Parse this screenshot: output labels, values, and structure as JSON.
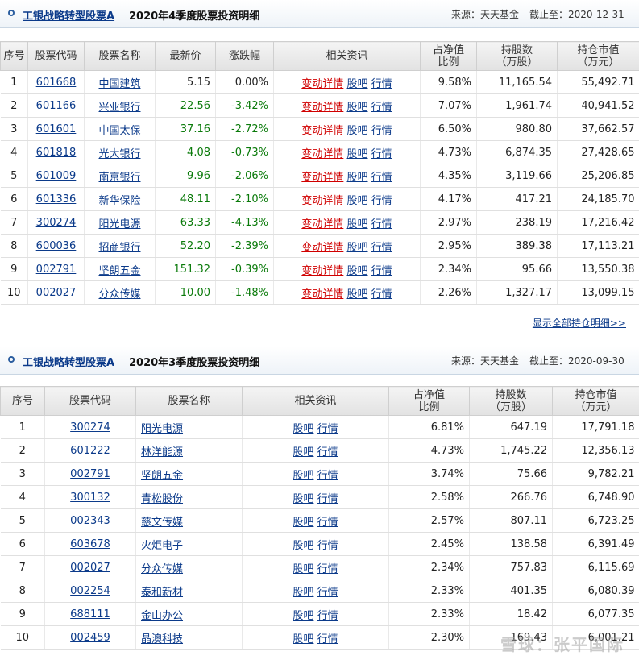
{
  "q4": {
    "fund_name": "工银战略转型股票A",
    "title": "2020年4季度股票投资明细",
    "source": "来源：天天基金",
    "deadline": "截止至：2020-12-31",
    "headers": [
      "序号",
      "股票代码",
      "股票名称",
      "最新价",
      "涨跌幅",
      "相关资讯",
      "占净值\n比例",
      "持股数\n（万股）",
      "持仓市值\n（万元）"
    ],
    "info_labels": {
      "change": "变动详情",
      "bar": "股吧",
      "quote": "行情"
    },
    "rows": [
      {
        "no": "1",
        "code": "601668",
        "name": "中国建筑",
        "price": "5.15",
        "chg": "0.00%",
        "dir": "flat",
        "ratio": "9.58%",
        "shares": "11,165.54",
        "value": "55,492.71"
      },
      {
        "no": "2",
        "code": "601166",
        "name": "兴业银行",
        "price": "22.56",
        "chg": "-3.42%",
        "dir": "down",
        "ratio": "7.07%",
        "shares": "1,961.74",
        "value": "40,941.52"
      },
      {
        "no": "3",
        "code": "601601",
        "name": "中国太保",
        "price": "37.16",
        "chg": "-2.72%",
        "dir": "down",
        "ratio": "6.50%",
        "shares": "980.80",
        "value": "37,662.57"
      },
      {
        "no": "4",
        "code": "601818",
        "name": "光大银行",
        "price": "4.08",
        "chg": "-0.73%",
        "dir": "down",
        "ratio": "4.73%",
        "shares": "6,874.35",
        "value": "27,428.65"
      },
      {
        "no": "5",
        "code": "601009",
        "name": "南京银行",
        "price": "9.96",
        "chg": "-2.06%",
        "dir": "down",
        "ratio": "4.35%",
        "shares": "3,119.66",
        "value": "25,206.85"
      },
      {
        "no": "6",
        "code": "601336",
        "name": "新华保险",
        "price": "48.11",
        "chg": "-2.10%",
        "dir": "down",
        "ratio": "4.17%",
        "shares": "417.21",
        "value": "24,185.70"
      },
      {
        "no": "7",
        "code": "300274",
        "name": "阳光电源",
        "price": "63.33",
        "chg": "-4.13%",
        "dir": "down",
        "ratio": "2.97%",
        "shares": "238.19",
        "value": "17,216.42"
      },
      {
        "no": "8",
        "code": "600036",
        "name": "招商银行",
        "price": "52.20",
        "chg": "-2.39%",
        "dir": "down",
        "ratio": "2.95%",
        "shares": "389.38",
        "value": "17,113.21"
      },
      {
        "no": "9",
        "code": "002791",
        "name": "坚朗五金",
        "price": "151.32",
        "chg": "-0.39%",
        "dir": "down",
        "ratio": "2.34%",
        "shares": "95.66",
        "value": "13,550.38"
      },
      {
        "no": "10",
        "code": "002027",
        "name": "分众传媒",
        "price": "10.00",
        "chg": "-1.48%",
        "dir": "down",
        "ratio": "2.26%",
        "shares": "1,327.17",
        "value": "13,099.15"
      }
    ],
    "show_all": "显示全部持仓明细>>"
  },
  "q3": {
    "fund_name": "工银战略转型股票A",
    "title": "2020年3季度股票投资明细",
    "source": "来源：天天基金",
    "deadline": "截止至：2020-09-30",
    "headers": [
      "序号",
      "股票代码",
      "股票名称",
      "相关资讯",
      "占净值\n比例",
      "持股数\n（万股）",
      "持仓市值\n（万元）"
    ],
    "info_labels": {
      "bar": "股吧",
      "quote": "行情"
    },
    "rows": [
      {
        "no": "1",
        "code": "300274",
        "name": "阳光电源",
        "ratio": "6.81%",
        "shares": "647.19",
        "value": "17,791.18"
      },
      {
        "no": "2",
        "code": "601222",
        "name": "林洋能源",
        "ratio": "4.73%",
        "shares": "1,745.22",
        "value": "12,356.13"
      },
      {
        "no": "3",
        "code": "002791",
        "name": "坚朗五金",
        "ratio": "3.74%",
        "shares": "75.66",
        "value": "9,782.21"
      },
      {
        "no": "4",
        "code": "300132",
        "name": "青松股份",
        "ratio": "2.58%",
        "shares": "266.76",
        "value": "6,748.90"
      },
      {
        "no": "5",
        "code": "002343",
        "name": "慈文传媒",
        "ratio": "2.57%",
        "shares": "807.11",
        "value": "6,723.25"
      },
      {
        "no": "6",
        "code": "603678",
        "name": "火炬电子",
        "ratio": "2.45%",
        "shares": "138.58",
        "value": "6,391.49"
      },
      {
        "no": "7",
        "code": "002027",
        "name": "分众传媒",
        "ratio": "2.34%",
        "shares": "757.83",
        "value": "6,115.69"
      },
      {
        "no": "8",
        "code": "002254",
        "name": "泰和新材",
        "ratio": "2.33%",
        "shares": "401.35",
        "value": "6,080.39"
      },
      {
        "no": "9",
        "code": "688111",
        "name": "金山办公",
        "ratio": "2.33%",
        "shares": "18.42",
        "value": "6,077.35"
      },
      {
        "no": "10",
        "code": "002459",
        "name": "晶澳科技",
        "ratio": "2.30%",
        "shares": "169.43",
        "value": "6,001.21"
      }
    ]
  },
  "watermark": "雪球：张平国际",
  "colors": {
    "link": "#0b3a8a",
    "up": "#d00000",
    "down": "#0a7a0a",
    "header_bg": "#e2e2e2"
  }
}
